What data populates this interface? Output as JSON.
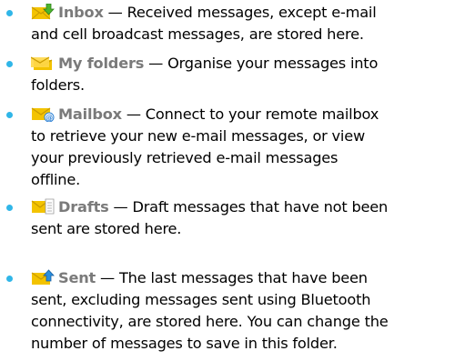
{
  "colors": {
    "bullet": "#30b6e8",
    "label": "#7a7a7a",
    "envelope": "#f3c300"
  },
  "items": [
    {
      "icon": "inbox-icon",
      "label": "Inbox",
      "line1": " — Received messages, except e-mail",
      "line2": "and cell broadcast messages, are stored here.",
      "line3": "",
      "line4": ""
    },
    {
      "icon": "my-folders-icon",
      "label": "My folders",
      "line1": " — Organise your messages into",
      "line2": "folders.",
      "line3": "",
      "line4": ""
    },
    {
      "icon": "mailbox-icon",
      "label": "Mailbox",
      "line1": " — Connect to your remote mailbox",
      "line2": "to retrieve your new e-mail messages, or view",
      "line3": "your previously retrieved e-mail messages",
      "line4": "offline."
    },
    {
      "icon": "drafts-icon",
      "label": "Drafts",
      "line1": " — Draft messages that have not been",
      "line2": "sent are stored here.",
      "line3": "",
      "line4": ""
    },
    {
      "icon": "sent-icon",
      "label": "Sent",
      "line1": " — The last messages that have been",
      "line2": "sent, excluding messages sent using Bluetooth",
      "line3": "connectivity, are stored here. You can change the",
      "line4": "number of messages to save in this folder."
    }
  ]
}
